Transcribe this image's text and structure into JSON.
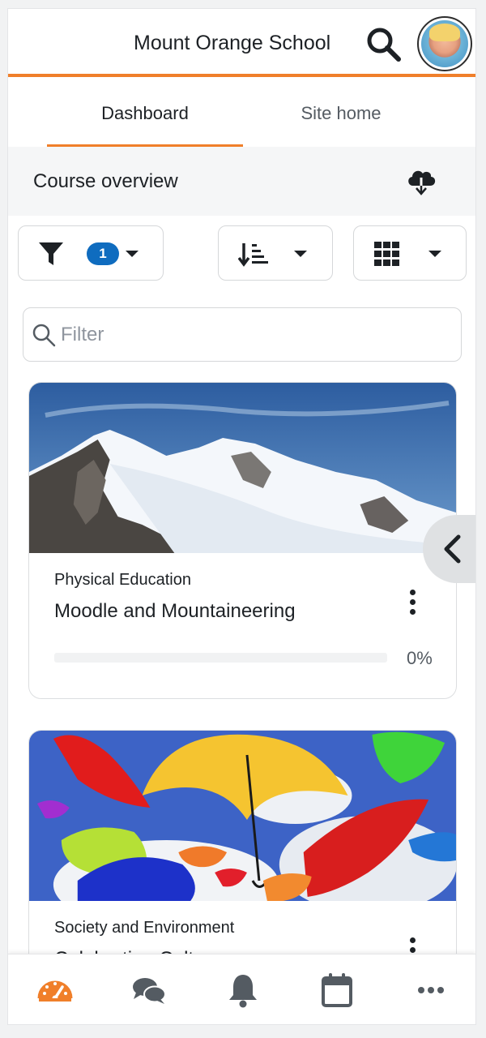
{
  "header": {
    "site_title": "Mount Orange School",
    "search_icon": "search-icon",
    "avatar": "user-avatar"
  },
  "tabs": [
    {
      "label": "Dashboard",
      "active": true
    },
    {
      "label": "Site home",
      "active": false
    }
  ],
  "course_overview": {
    "title": "Course overview",
    "download_icon": "cloud-download-icon"
  },
  "controls": {
    "filter_icon": "filter-icon",
    "filter_count": "1",
    "sort_icon": "sort-icon",
    "view_icon": "grid-view-icon",
    "search_placeholder": "Filter"
  },
  "courses": [
    {
      "category": "Physical Education",
      "name": "Moodle and Mountaineering",
      "progress_percent": 0,
      "progress_label": "0%",
      "image": "snowy-mountains"
    },
    {
      "category": "Society and Environment",
      "name": "Celebrating Cultures",
      "image": "colorful-umbrellas"
    }
  ],
  "bottom_nav": [
    {
      "icon": "dashboard-icon",
      "active": true
    },
    {
      "icon": "messages-icon",
      "active": false
    },
    {
      "icon": "notifications-bell-icon",
      "active": false
    },
    {
      "icon": "calendar-icon",
      "active": false
    },
    {
      "icon": "more-icon",
      "active": false
    }
  ],
  "colors": {
    "accent": "#f07f2a",
    "primary": "#0f6cbf",
    "text": "#1d2125",
    "muted": "#545b62"
  }
}
